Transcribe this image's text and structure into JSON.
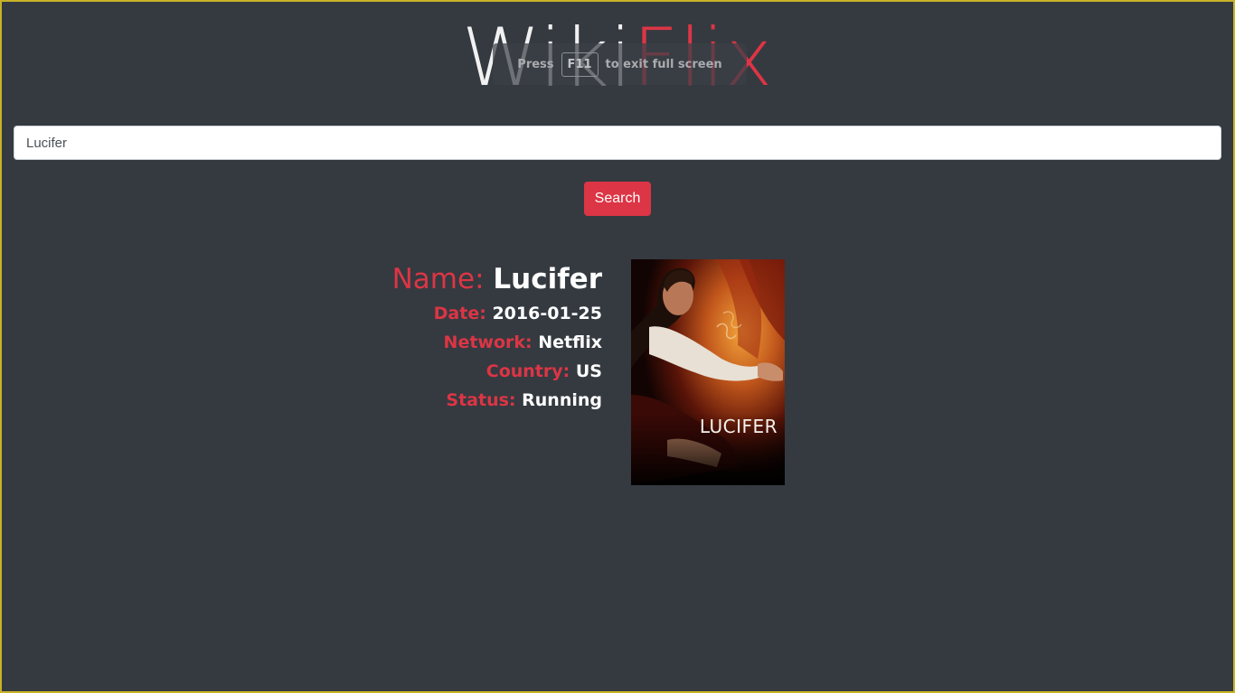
{
  "header": {
    "logo_wiki": "Wiki",
    "logo_flix": "Flix"
  },
  "fullscreen_notice": {
    "press": "Press",
    "key": "F11",
    "suffix": "to exit full screen"
  },
  "search": {
    "value": "Lucifer",
    "button_label": "Search"
  },
  "show": {
    "name_label": "Name:",
    "name": "Lucifer",
    "date_label": "Date:",
    "date": "2016-01-25",
    "network_label": "Network:",
    "network": "Netflix",
    "country_label": "Country:",
    "country": "US",
    "status_label": "Status:",
    "status": "Running",
    "poster_title": "LUCIFER"
  },
  "colors": {
    "accent": "#dc3545",
    "background": "#343a40"
  }
}
